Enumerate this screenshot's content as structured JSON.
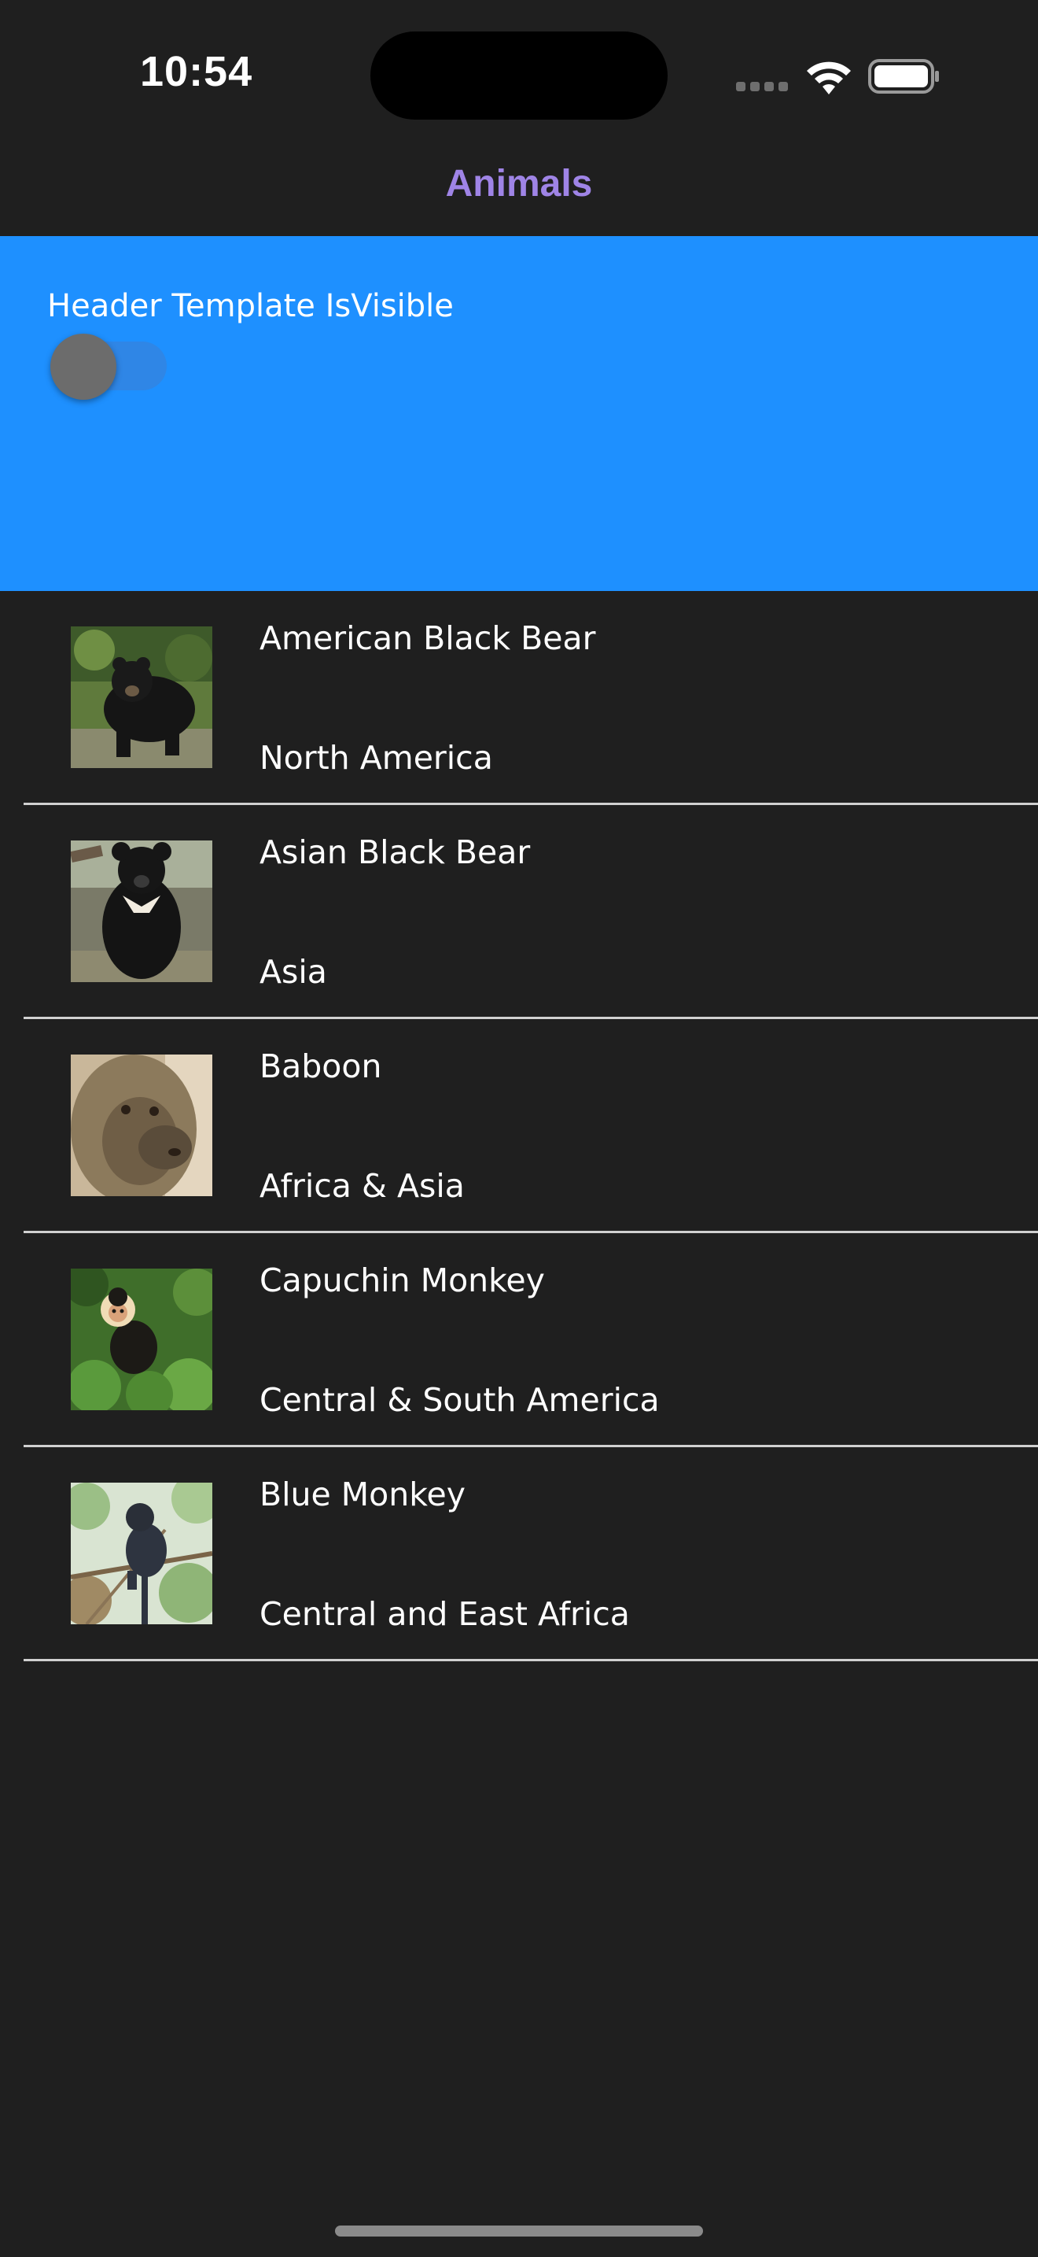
{
  "status_bar": {
    "time": "10:54"
  },
  "nav": {
    "title": "Animals"
  },
  "header": {
    "label": "Header Template IsVisible",
    "toggle_on": false
  },
  "animals": [
    {
      "name": "American Black Bear",
      "location": "North America",
      "image": "american-black-bear-photo"
    },
    {
      "name": "Asian Black Bear",
      "location": "Asia",
      "image": "asian-black-bear-photo"
    },
    {
      "name": "Baboon",
      "location": "Africa & Asia",
      "image": "baboon-photo"
    },
    {
      "name": "Capuchin Monkey",
      "location": "Central & South America",
      "image": "capuchin-monkey-photo"
    },
    {
      "name": "Blue Monkey",
      "location": "Central and East Africa",
      "image": "blue-monkey-photo"
    }
  ],
  "colors": {
    "background": "#1f1f1f",
    "header_background": "#1e90ff",
    "title_accent": "#9f84e6",
    "divider": "#d0d0d0"
  }
}
